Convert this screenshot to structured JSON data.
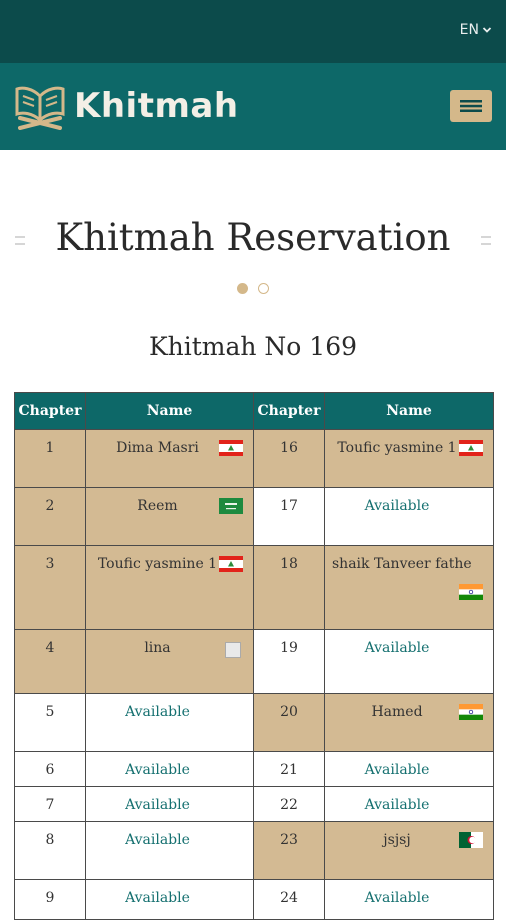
{
  "header": {
    "language": "EN",
    "brand": "Khitmah"
  },
  "page": {
    "title": "Khitmah Reservation",
    "subtitle": "Khitmah No 169"
  },
  "table": {
    "headers": [
      "Chapter",
      "Name",
      "Chapter",
      "Name"
    ],
    "rows": [
      {
        "ch_a": "1",
        "name_a": "Dima Masri",
        "status_a": "reserved",
        "flag_a": "lebanon-flag",
        "ch_b": "16",
        "name_b": "Toufic yasmine 1",
        "status_b": "reserved",
        "flag_b": "lebanon-flag"
      },
      {
        "ch_a": "2",
        "name_a": "Reem",
        "status_a": "reserved",
        "flag_a": "saudi-flag",
        "ch_b": "17",
        "name_b": "Available",
        "status_b": "free",
        "flag_b": ""
      },
      {
        "ch_a": "3",
        "name_a": "Toufic yasmine 1",
        "status_a": "reserved",
        "flag_a": "lebanon-flag",
        "ch_b": "18",
        "name_b": "shaik Tanveer fathe",
        "status_b": "reserved",
        "flag_b": "india-flag"
      },
      {
        "ch_a": "4",
        "name_a": "lina",
        "status_a": "reserved",
        "flag_a": "broken-image",
        "ch_b": "19",
        "name_b": "Available",
        "status_b": "free",
        "flag_b": ""
      },
      {
        "ch_a": "5",
        "name_a": "Available",
        "status_a": "free",
        "flag_a": "",
        "ch_b": "20",
        "name_b": "Hamed",
        "status_b": "reserved",
        "flag_b": "india-flag"
      },
      {
        "ch_a": "6",
        "name_a": "Available",
        "status_a": "free",
        "flag_a": "",
        "ch_b": "21",
        "name_b": "Available",
        "status_b": "free",
        "flag_b": ""
      },
      {
        "ch_a": "7",
        "name_a": "Available",
        "status_a": "free",
        "flag_a": "",
        "ch_b": "22",
        "name_b": "Available",
        "status_b": "free",
        "flag_b": ""
      },
      {
        "ch_a": "8",
        "name_a": "Available",
        "status_a": "free",
        "flag_a": "",
        "ch_b": "23",
        "name_b": "jsjsj",
        "status_b": "reserved",
        "flag_b": "algeria-flag"
      },
      {
        "ch_a": "9",
        "name_a": "Available",
        "status_a": "free",
        "flag_a": "",
        "ch_b": "24",
        "name_b": "Available",
        "status_b": "free",
        "flag_b": ""
      }
    ]
  },
  "colors": {
    "topbar": "#0c4b4b",
    "brandbar": "#0d6868",
    "accent_gold": "#d4b88a",
    "reserved_cell": "#d3ba93",
    "available_text": "#157070"
  },
  "icons": {
    "language_caret": "chevron-down-icon",
    "logo": "open-book-logo",
    "menu": "hamburger-menu-icon"
  }
}
